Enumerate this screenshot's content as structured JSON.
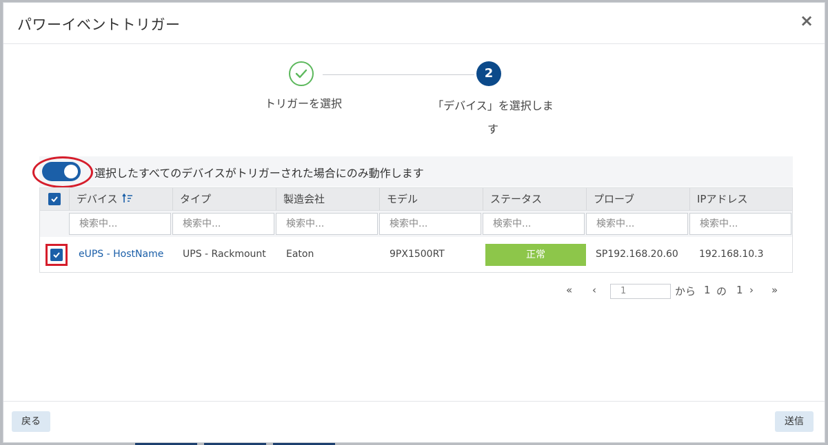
{
  "dialog": {
    "title": "パワーイベントトリガー",
    "close_glyph": "×"
  },
  "stepper": {
    "steps": [
      {
        "label": "トリガーを選択",
        "state": "complete"
      },
      {
        "number": "2",
        "label_line1": "「デバイス」を選択しま",
        "label_line2": "す",
        "state": "active"
      }
    ]
  },
  "toggle": {
    "label": "選択したすべてのデバイスがトリガーされた場合にのみ動作します",
    "on": true
  },
  "table": {
    "columns": [
      "デバイス",
      "タイプ",
      "製造会社",
      "モデル",
      "ステータス",
      "プローブ",
      "IPアドレス"
    ],
    "filter_placeholder": "検索中...",
    "rows": [
      {
        "checked": true,
        "device": "eUPS - HostName",
        "type": "UPS - Rackmount",
        "manufacturer": "Eaton",
        "model": "9PX1500RT",
        "status": "正常",
        "probe": "SP192.168.20.60",
        "ip": "192.168.10.3"
      }
    ]
  },
  "pager": {
    "first": "«",
    "prev": "‹",
    "page": "1",
    "of_label": "から",
    "current": "1",
    "sep": "の",
    "total": "1",
    "next": "›",
    "last": "»"
  },
  "footer": {
    "back_label": "戻る",
    "send_label": "送信"
  },
  "colors": {
    "primary": "#1b5fa8",
    "step_active": "#0c4a8a",
    "step_complete": "#5cb85c",
    "status_ok": "#8dc64a",
    "highlight": "#d51d2b"
  }
}
